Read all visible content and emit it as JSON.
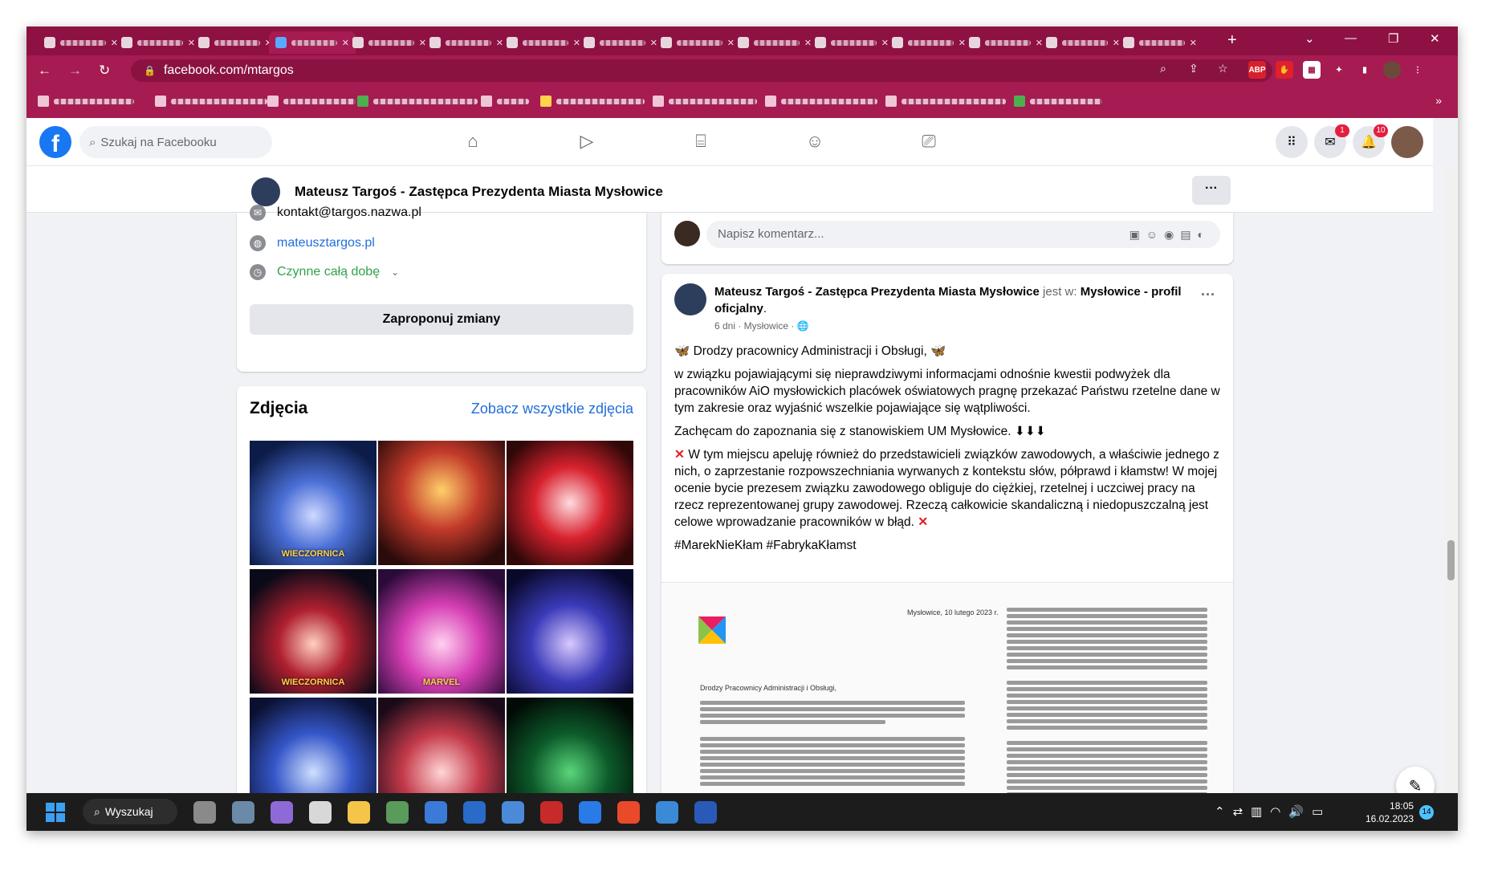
{
  "browser": {
    "url": "facebook.com/mtargos",
    "window_controls": [
      "⌄",
      "—",
      "❐",
      "✕"
    ],
    "new_tab_icon": "+",
    "bookmarks_more": "»",
    "extension_label": "ABP"
  },
  "facebook": {
    "search_placeholder": "Szukaj na Facebooku",
    "page_name": "Mateusz Targoś - Zastępca Prezydenta Miasta Mysłowice",
    "page_more": "···",
    "notification_badges": [
      "1",
      "10"
    ]
  },
  "intro": {
    "email": "kontakt@targos.nazwa.pl",
    "website": "mateusztargos.pl",
    "hours": "Czynne całą dobę",
    "suggest_button": "Zaproponuj zmiany"
  },
  "photos": {
    "title": "Zdjęcia",
    "see_all": "Zobacz wszystkie zdjęcia"
  },
  "comment": {
    "placeholder": "Napisz komentarz..."
  },
  "post": {
    "author": "Mateusz Targoś - Zastępca Prezydenta Miasta Mysłowice",
    "is_at": " jest w: ",
    "place": "Mysłowice - profil oficjalny",
    "meta": "6 dni · Mysłowice · 🌐",
    "more": "···",
    "greeting": "🦋 Drodzy pracownicy Administracji i Obsługi, 🦋",
    "p1": "w związku pojawiającymi się nieprawdziwymi informacjami odnośnie kwestii podwyżek dla pracowników AiO mysłowickich placówek oświatowych pragnę przekazać Państwu rzetelne dane w tym zakresie oraz wyjaśnić wszelkie pojawiające się wątpliwości.",
    "p2": "Zachęcam do zapoznania się z stanowiskiem UM Mysłowice. ⬇⬇⬇",
    "p3": "W tym miejscu apeluję również do przedstawicieli związków zawodowych, a właściwie jednego z nich, o zaprzestanie rozpowszechniania wyrwanych z kontekstu słów, półprawd i kłamstw! W mojej ocenie bycie prezesem związku zawodowego obliguje do ciężkiej, rzetelnej i uczciwej pracy na rzecz reprezentowanej grupy zawodowej. Rzeczą całkowicie skandaliczną i niedopuszczalną jest celowe wprowadzanie pracowników w błąd.",
    "hashtags": "#MarekNieKłam #FabrykaKłamst",
    "x_mark": "✕"
  },
  "document": {
    "date": "Mysłowice, 10 lutego 2023 r.",
    "greeting": "Drodzy Pracownicy Administracji i Obsługi,"
  },
  "taskbar": {
    "search": "Wyszukaj",
    "time": "18:05",
    "date": "16.02.2023",
    "notifications": "14"
  }
}
